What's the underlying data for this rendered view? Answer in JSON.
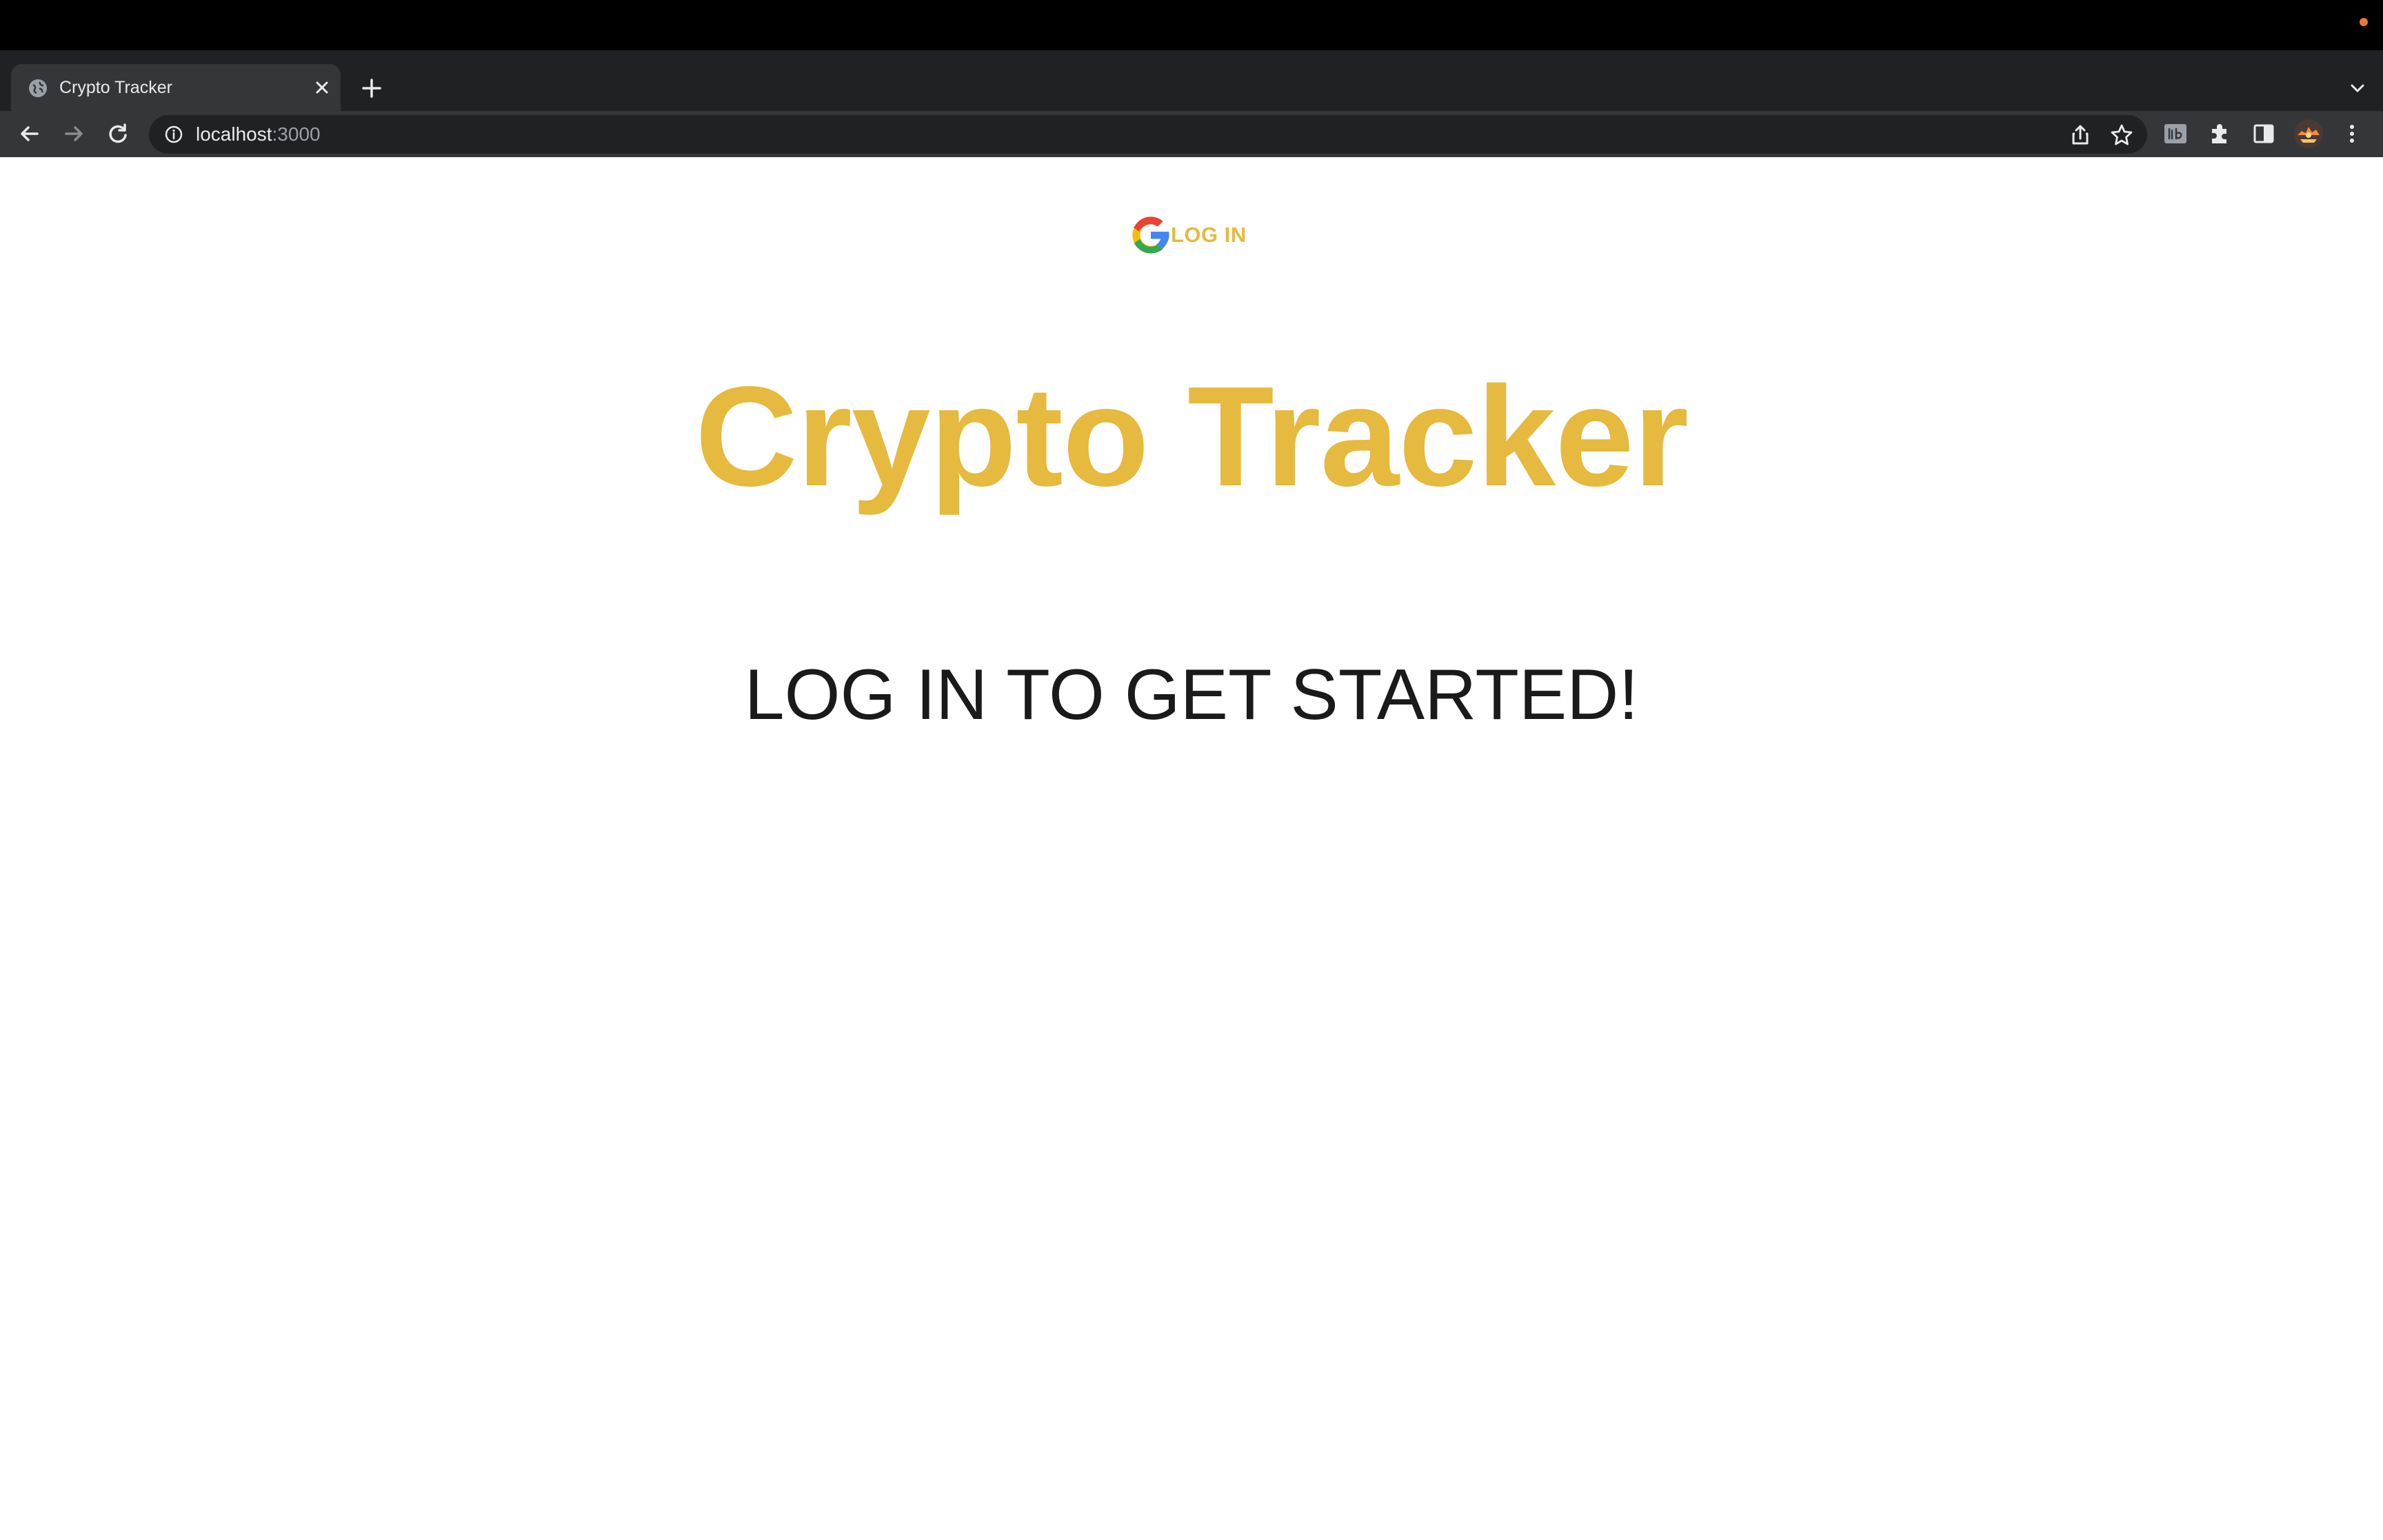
{
  "browser": {
    "tab": {
      "title": "Crypto Tracker"
    },
    "address_bar": {
      "host": "localhost",
      "port": ":3000"
    }
  },
  "icons": {
    "favicon": "globe-icon",
    "tab_close": "close-icon",
    "new_tab": "plus-icon",
    "tab_search": "chevron-down-icon",
    "back": "arrow-left-icon",
    "forward": "arrow-right-icon",
    "reload": "reload-icon",
    "site_info": "info-icon",
    "share": "share-icon",
    "bookmark": "star-icon",
    "extension": "extension-badge-icon",
    "extensions": "puzzle-icon",
    "side_panel": "side-panel-icon",
    "profile": "avatar",
    "menu": "kebab-menu-icon",
    "google": "google-g-icon"
  },
  "page": {
    "login_button": {
      "label": "LOG IN"
    },
    "title": "Crypto Tracker",
    "subtitle": "LOG IN TO GET STARTED!"
  },
  "colors": {
    "accent": "#e6b93f",
    "text": "#1a1a1a",
    "chrome_dark": "#202124",
    "chrome_mid": "#35363a"
  }
}
